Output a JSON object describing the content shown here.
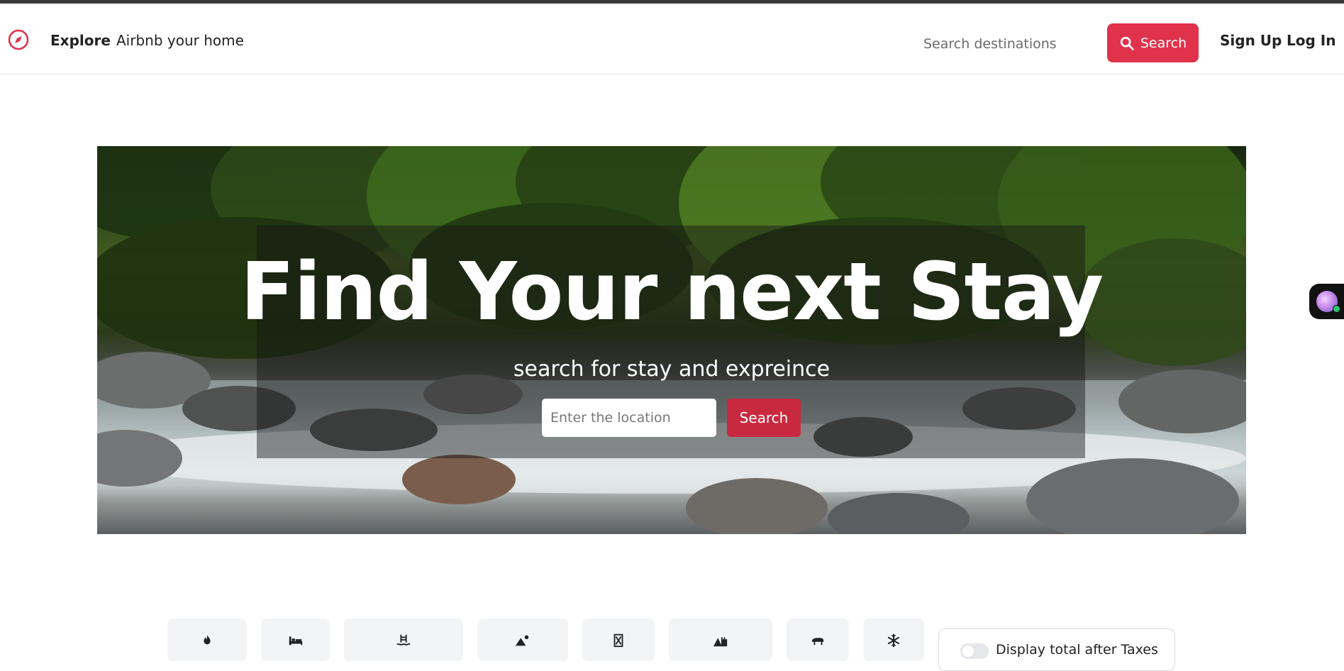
{
  "navbar": {
    "explore_label": "Explore",
    "host_label": "Airbnb your home",
    "search_placeholder": "Search destinations",
    "search_button_label": "Search",
    "signup_label": "Sign Up",
    "login_label": "Log In"
  },
  "hero": {
    "title": "Find Your next Stay",
    "subtitle": "search for stay and expreince",
    "input_placeholder": "Enter the location",
    "button_label": "Search"
  },
  "categories": [
    {
      "icon": "flame-icon"
    },
    {
      "icon": "bed-icon"
    },
    {
      "icon": "pool-icon"
    },
    {
      "icon": "mountain-icon"
    },
    {
      "icon": "tower-icon"
    },
    {
      "icon": "castle-icon"
    },
    {
      "icon": "farm-icon"
    },
    {
      "icon": "snowflake-icon"
    }
  ],
  "taxes_toggle": {
    "label": "Display total after Taxes",
    "enabled": false
  },
  "colors": {
    "accent": "#e0324b",
    "hero_button": "#c9293f",
    "text": "#222222"
  }
}
